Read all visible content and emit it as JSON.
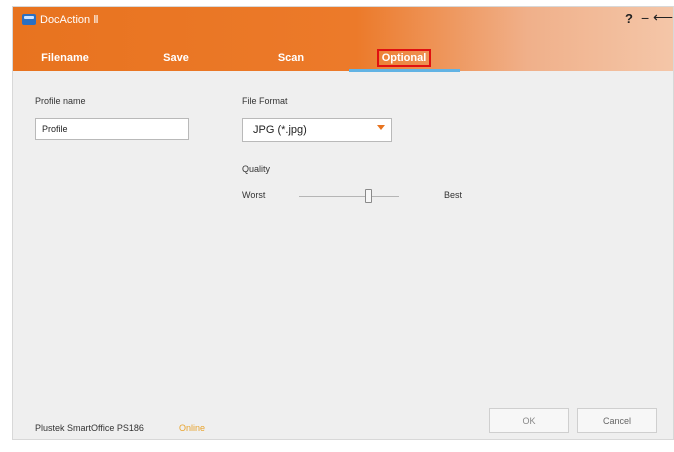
{
  "window": {
    "app_title": "DocAction Ⅱ",
    "controls": {
      "help": "?",
      "minimize": "−",
      "back": "⟵"
    }
  },
  "tabs": [
    {
      "label": "Filename"
    },
    {
      "label": "Save"
    },
    {
      "label": "Scan"
    },
    {
      "label": "Optional",
      "active": true
    }
  ],
  "form": {
    "profile_label": "Profile name",
    "profile_value": "Profile",
    "format_label": "File Format",
    "format_value": "JPG (*.jpg)",
    "quality_label": "Quality",
    "quality_min": "Worst",
    "quality_max": "Best",
    "quality_level": 0.72
  },
  "footer": {
    "device_name": "Plustek SmartOffice PS186",
    "device_status": "Online",
    "ok_label": "OK",
    "cancel_label": "Cancel"
  },
  "colors": {
    "accent": "#e8731f",
    "tab_underline": "#62b3e4",
    "status": "#e8a32d",
    "highlight_box": "#e01010"
  },
  "icons": {
    "app": "scanner-icon",
    "format_dropdown": "chevron-down-icon"
  }
}
